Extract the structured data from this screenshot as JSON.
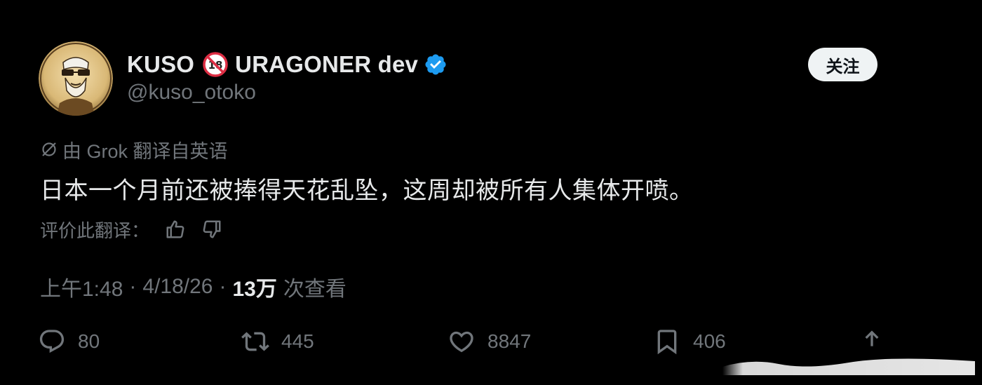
{
  "user": {
    "display_name_part1": "KUSO",
    "emoji": "18-prohibited-emoji",
    "display_name_part2": "URAGONER dev",
    "handle": "@kuso_otoko",
    "verified": true
  },
  "follow_button": {
    "label": "关注"
  },
  "translation": {
    "label": "由 Grok 翻译自英语",
    "icon": "grok-icon"
  },
  "tweet": {
    "text": "日本一个月前还被捧得天花乱坠，这周却被所有人集体开喷。"
  },
  "rate_translation": {
    "label": "评价此翻译："
  },
  "meta": {
    "time": "上午1:48",
    "date": "4/18/26",
    "separator": "·",
    "views_count": "13万",
    "views_label": "次查看"
  },
  "actions": {
    "replies": "80",
    "retweets": "445",
    "likes": "8847",
    "bookmarks": "406"
  },
  "colors": {
    "background": "#000000",
    "primary_text": "#e7e9ea",
    "secondary_text": "#71767b",
    "verified_blue": "#1d9bf0",
    "follow_bg": "#eff3f4"
  }
}
